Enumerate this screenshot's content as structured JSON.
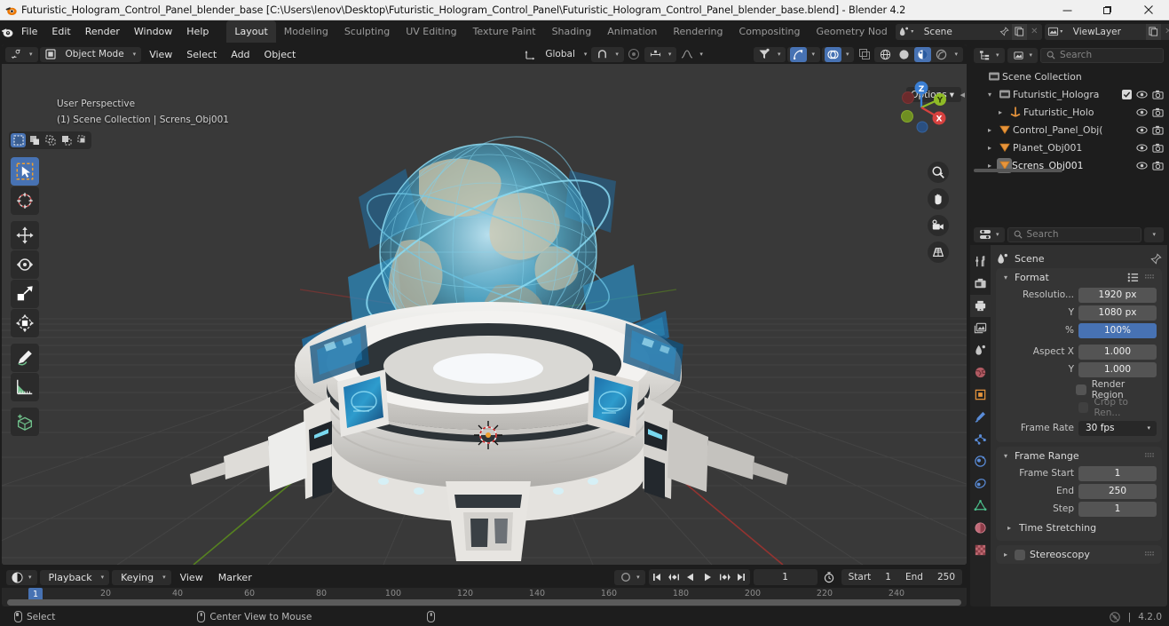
{
  "window": {
    "title": "Futuristic_Hologram_Control_Panel_blender_base [C:\\Users\\lenov\\Desktop\\Futuristic_Hologram_Control_Panel\\Futuristic_Hologram_Control_Panel_blender_base.blend] - Blender 4.2",
    "minimize": "─",
    "maximize": "❐",
    "close": "✕"
  },
  "topbar": {
    "menus": [
      "File",
      "Edit",
      "Render",
      "Window",
      "Help"
    ],
    "workspaces": [
      {
        "label": "Layout",
        "active": true
      },
      {
        "label": "Modeling",
        "active": false
      },
      {
        "label": "Sculpting",
        "active": false
      },
      {
        "label": "UV Editing",
        "active": false
      },
      {
        "label": "Texture Paint",
        "active": false
      },
      {
        "label": "Shading",
        "active": false
      },
      {
        "label": "Animation",
        "active": false
      },
      {
        "label": "Rendering",
        "active": false
      },
      {
        "label": "Compositing",
        "active": false
      },
      {
        "label": "Geometry Nod",
        "active": false
      }
    ],
    "scene_name": "Scene",
    "viewlayer_name": "ViewLayer"
  },
  "viewport": {
    "mode": "Object Mode",
    "menus": [
      "View",
      "Select",
      "Add",
      "Object"
    ],
    "transform_orientation": "Global",
    "options_label": "Options",
    "overlay_line1": "User Perspective",
    "overlay_line2": "(1) Scene Collection | Screns_Obj001",
    "gizmo_axes": {
      "x": "X",
      "y": "Y",
      "z": "Z"
    }
  },
  "timeline": {
    "menus": [
      "Playback",
      "Keying",
      "View",
      "Marker"
    ],
    "current_frame": "1",
    "start_label": "Start",
    "start_value": "1",
    "end_label": "End",
    "end_value": "250",
    "ruler_ticks": [
      "20",
      "40",
      "60",
      "80",
      "100",
      "120",
      "140",
      "160",
      "180",
      "200",
      "220",
      "240"
    ],
    "playhead_label": "1"
  },
  "outliner": {
    "search_placeholder": "Search",
    "rows": [
      {
        "name": "Scene Collection",
        "icon": "collection-icon",
        "indent": 0,
        "arrow": "",
        "selected": false,
        "has_toggles": false
      },
      {
        "name": "Futuristic_Hologra",
        "icon": "collection-icon",
        "indent": 1,
        "arrow": "▾",
        "selected": false,
        "has_toggles": true,
        "has_checkbox": true
      },
      {
        "name": "Futuristic_Holo",
        "icon": "empty-axes-icon",
        "indent": 2,
        "arrow": "▸",
        "selected": false,
        "has_toggles": true,
        "has_checkbox": false
      },
      {
        "name": "Control_Panel_Obj(",
        "icon": "mesh-icon",
        "indent": 1,
        "arrow": "▸",
        "selected": false,
        "has_toggles": true,
        "has_checkbox": false
      },
      {
        "name": "Planet_Obj001",
        "icon": "mesh-icon",
        "indent": 1,
        "arrow": "▸",
        "selected": false,
        "has_toggles": true,
        "has_checkbox": false
      },
      {
        "name": "Screns_Obj001",
        "icon": "mesh-icon",
        "indent": 1,
        "arrow": "▸",
        "selected": true,
        "has_toggles": true,
        "has_checkbox": false
      }
    ]
  },
  "properties": {
    "search_placeholder": "Search",
    "breadcrumb": "Scene",
    "format_panel": {
      "title": "Format",
      "rows": [
        {
          "label": "Resolutio...",
          "value": "1920 px",
          "style": "normal"
        },
        {
          "label": "Y",
          "value": "1080 px",
          "style": "normal"
        },
        {
          "label": "%",
          "value": "100%",
          "style": "blue"
        },
        {
          "label": "Aspect X",
          "value": "1.000",
          "style": "normal"
        },
        {
          "label": "Y",
          "value": "1.000",
          "style": "normal"
        }
      ],
      "render_region_label": "Render Region",
      "crop_label": "Crop to Ren...",
      "frame_rate_label": "Frame Rate",
      "frame_rate_value": "30 fps"
    },
    "frame_range_panel": {
      "title": "Frame Range",
      "rows": [
        {
          "label": "Frame Start",
          "value": "1"
        },
        {
          "label": "End",
          "value": "250"
        },
        {
          "label": "Step",
          "value": "1"
        }
      ],
      "time_stretching_label": "Time Stretching"
    },
    "stereoscopy_label": "Stereoscopy"
  },
  "statusbar": {
    "items": [
      {
        "text": "Select",
        "icon": "mouse-left-icon"
      },
      {
        "text": "Center View to Mouse",
        "icon": "mouse-middle-icon"
      },
      {
        "text": "",
        "icon": "mouse-right-icon"
      }
    ],
    "version": "4.2.0"
  },
  "colors": {
    "accent_blue": "#4772b3",
    "editor_bg": "#1d1d1d",
    "viewport_bg": "#393939",
    "panel_bg": "#303030",
    "field_bg": "#545454",
    "mesh_orange": "#e8953c",
    "axis_x": "#d6413f",
    "axis_y": "#8fbb27",
    "axis_z": "#3b7fd4"
  }
}
